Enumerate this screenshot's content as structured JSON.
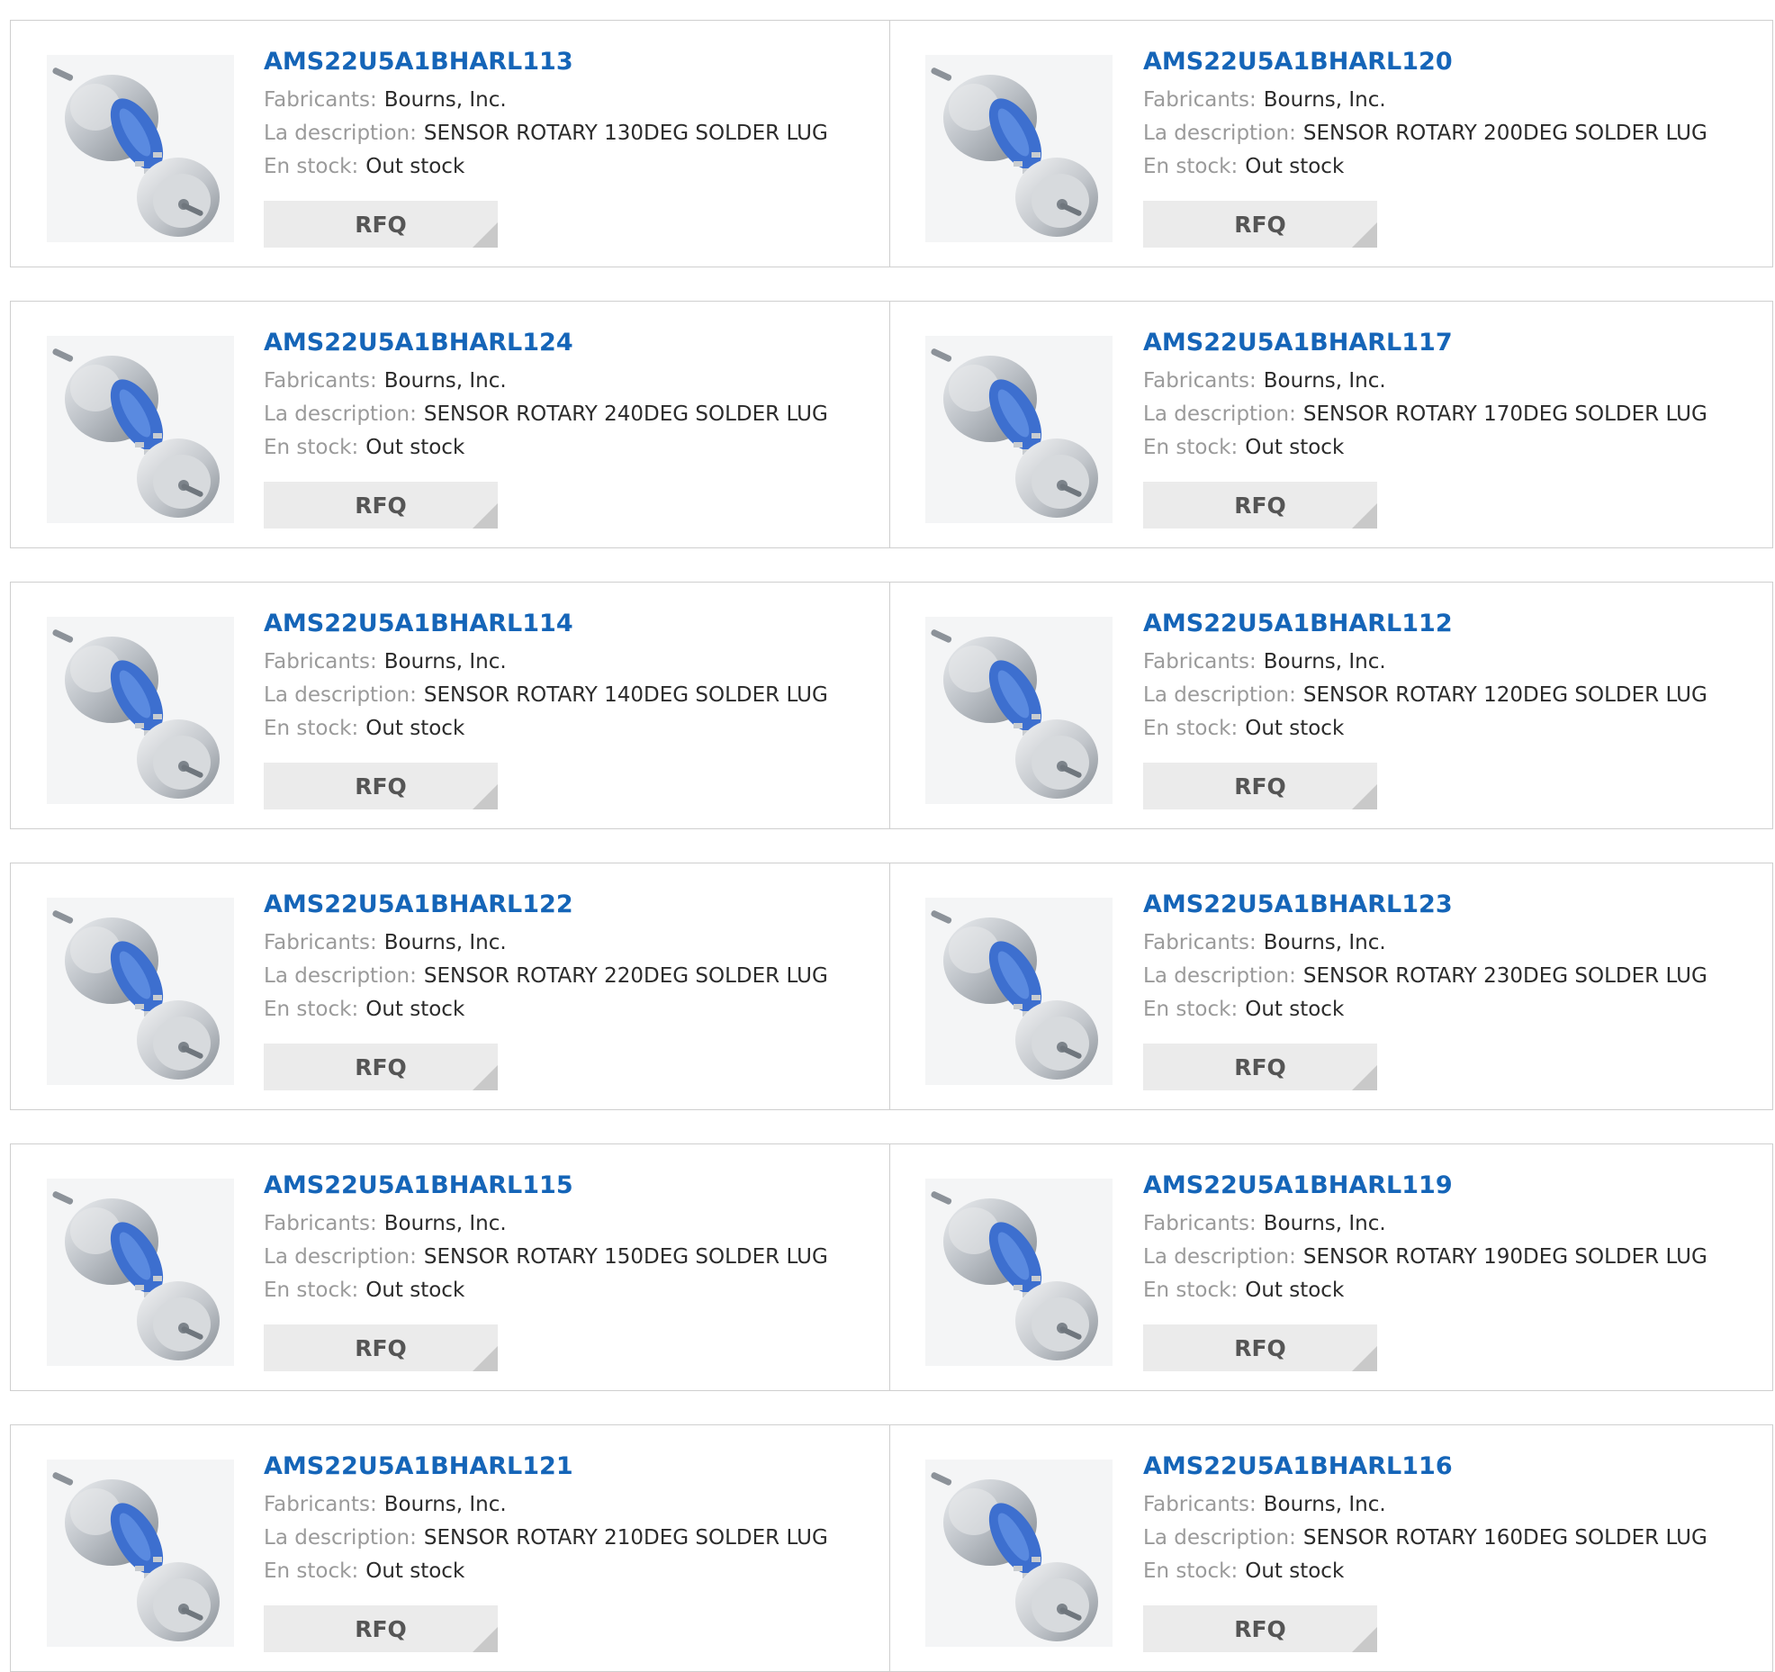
{
  "labels": {
    "manufacturer": "Fabricants:",
    "description": "La description:",
    "stock": "En stock:",
    "rfq": "RFQ"
  },
  "colors": {
    "link": "#1565b8",
    "label": "#9a9a9a",
    "value": "#2b2b2b",
    "button_bg": "#ebebeb",
    "border": "#cfcfcf",
    "sensor_blue": "#3d6fcf"
  },
  "products": [
    {
      "part": "AMS22U5A1BHARL113",
      "manufacturer": "Bourns, Inc.",
      "description": "SENSOR ROTARY 130DEG SOLDER LUG",
      "stock": "Out stock",
      "image_icon": "rotary-sensor-image"
    },
    {
      "part": "AMS22U5A1BHARL120",
      "manufacturer": "Bourns, Inc.",
      "description": "SENSOR ROTARY 200DEG SOLDER LUG",
      "stock": "Out stock",
      "image_icon": "rotary-sensor-image"
    },
    {
      "part": "AMS22U5A1BHARL124",
      "manufacturer": "Bourns, Inc.",
      "description": "SENSOR ROTARY 240DEG SOLDER LUG",
      "stock": "Out stock",
      "image_icon": "rotary-sensor-image"
    },
    {
      "part": "AMS22U5A1BHARL117",
      "manufacturer": "Bourns, Inc.",
      "description": "SENSOR ROTARY 170DEG SOLDER LUG",
      "stock": "Out stock",
      "image_icon": "rotary-sensor-image"
    },
    {
      "part": "AMS22U5A1BHARL114",
      "manufacturer": "Bourns, Inc.",
      "description": "SENSOR ROTARY 140DEG SOLDER LUG",
      "stock": "Out stock",
      "image_icon": "rotary-sensor-image"
    },
    {
      "part": "AMS22U5A1BHARL112",
      "manufacturer": "Bourns, Inc.",
      "description": "SENSOR ROTARY 120DEG SOLDER LUG",
      "stock": "Out stock",
      "image_icon": "rotary-sensor-image"
    },
    {
      "part": "AMS22U5A1BHARL122",
      "manufacturer": "Bourns, Inc.",
      "description": "SENSOR ROTARY 220DEG SOLDER LUG",
      "stock": "Out stock",
      "image_icon": "rotary-sensor-image"
    },
    {
      "part": "AMS22U5A1BHARL123",
      "manufacturer": "Bourns, Inc.",
      "description": "SENSOR ROTARY 230DEG SOLDER LUG",
      "stock": "Out stock",
      "image_icon": "rotary-sensor-image"
    },
    {
      "part": "AMS22U5A1BHARL115",
      "manufacturer": "Bourns, Inc.",
      "description": "SENSOR ROTARY 150DEG SOLDER LUG",
      "stock": "Out stock",
      "image_icon": "rotary-sensor-image"
    },
    {
      "part": "AMS22U5A1BHARL119",
      "manufacturer": "Bourns, Inc.",
      "description": "SENSOR ROTARY 190DEG SOLDER LUG",
      "stock": "Out stock",
      "image_icon": "rotary-sensor-image"
    },
    {
      "part": "AMS22U5A1BHARL121",
      "manufacturer": "Bourns, Inc.",
      "description": "SENSOR ROTARY 210DEG SOLDER LUG",
      "stock": "Out stock",
      "image_icon": "rotary-sensor-image"
    },
    {
      "part": "AMS22U5A1BHARL116",
      "manufacturer": "Bourns, Inc.",
      "description": "SENSOR ROTARY 160DEG SOLDER LUG",
      "stock": "Out stock",
      "image_icon": "rotary-sensor-image"
    }
  ]
}
